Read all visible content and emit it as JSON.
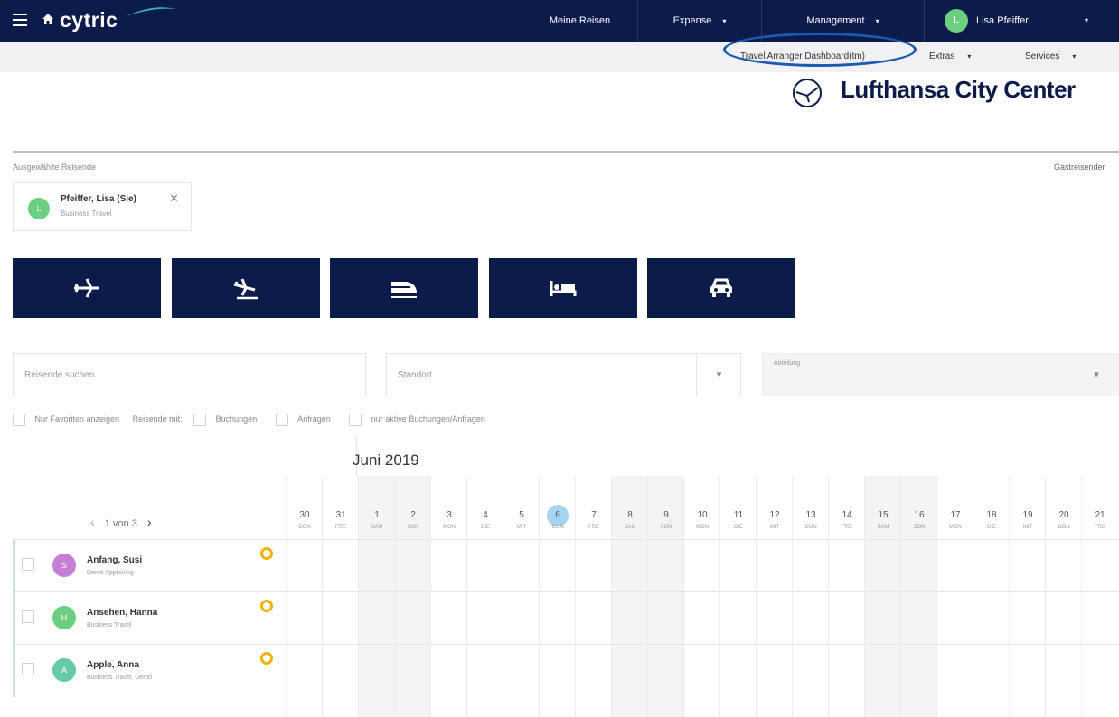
{
  "app": {
    "logo": "cytric"
  },
  "nav": {
    "items": [
      {
        "label": "Meine Reisen"
      },
      {
        "label": "Expense",
        "caret": "▾"
      },
      {
        "label": "Management",
        "caret": "▾"
      }
    ],
    "user": {
      "initial": "L",
      "name": "Lisa Pfeiffer",
      "caret": "▾",
      "avatar_color": "#6ccf7f"
    }
  },
  "subnav": {
    "dashboard": "Travel Arranger Dashboard(tm)",
    "extras": "Extras",
    "services": "Services",
    "caret": "▾"
  },
  "brand": {
    "name": "Lufthansa City Center"
  },
  "selected": {
    "label": "Ausgewählte Reisende",
    "guest_link": "Gastreisender",
    "traveler": {
      "initial": "L",
      "name": "Pfeiffer, Lisa (Sie)",
      "subtitle": "Business Travel",
      "close": "✕"
    }
  },
  "services": [
    {
      "icon": "airplane-icon"
    },
    {
      "icon": "airplane-arrival-icon"
    },
    {
      "icon": "train-icon"
    },
    {
      "icon": "hotel-bed-icon"
    },
    {
      "icon": "car-icon"
    }
  ],
  "search": {
    "traveler_placeholder": "Reisende suchen",
    "location_placeholder": "Standort",
    "department_placeholder": "Abteilung",
    "caret": "▾"
  },
  "filters": {
    "favorites": "Nur Favoriten anzeigen",
    "travelers_with": "Reisende mit:",
    "bookings": "Buchungen",
    "requests": "Anfragen",
    "active_only": "nur aktive Buchungen/Anfragen"
  },
  "calendar": {
    "month": "Juni 2019",
    "pager": {
      "prev": "‹",
      "text": "1 von 3",
      "next": "›"
    },
    "today_index": 7,
    "days": [
      {
        "num": "30",
        "dow": "DON",
        "weekend": false
      },
      {
        "num": "31",
        "dow": "FRE",
        "weekend": false
      },
      {
        "num": "1",
        "dow": "SAM",
        "weekend": true
      },
      {
        "num": "2",
        "dow": "SON",
        "weekend": true
      },
      {
        "num": "3",
        "dow": "MON",
        "weekend": false
      },
      {
        "num": "4",
        "dow": "DIE",
        "weekend": false
      },
      {
        "num": "5",
        "dow": "MIT",
        "weekend": false
      },
      {
        "num": "6",
        "dow": "DON",
        "weekend": false
      },
      {
        "num": "7",
        "dow": "FRE",
        "weekend": false
      },
      {
        "num": "8",
        "dow": "SAM",
        "weekend": true
      },
      {
        "num": "9",
        "dow": "SON",
        "weekend": true
      },
      {
        "num": "10",
        "dow": "MON",
        "weekend": false
      },
      {
        "num": "11",
        "dow": "DIE",
        "weekend": false
      },
      {
        "num": "12",
        "dow": "MIT",
        "weekend": false
      },
      {
        "num": "13",
        "dow": "DON",
        "weekend": false
      },
      {
        "num": "14",
        "dow": "FRE",
        "weekend": false
      },
      {
        "num": "15",
        "dow": "SAM",
        "weekend": true
      },
      {
        "num": "16",
        "dow": "SON",
        "weekend": true
      },
      {
        "num": "17",
        "dow": "MON",
        "weekend": false
      },
      {
        "num": "18",
        "dow": "DIE",
        "weekend": false
      },
      {
        "num": "19",
        "dow": "MIT",
        "weekend": false
      },
      {
        "num": "20",
        "dow": "DON",
        "weekend": false
      },
      {
        "num": "21",
        "dow": "FRE",
        "weekend": false
      }
    ],
    "travelers": [
      {
        "initial": "S",
        "name": "Anfang, Susi",
        "subtitle": "Demo Approving",
        "color": "#c77fd6"
      },
      {
        "initial": "H",
        "name": "Ansehen, Hanna",
        "subtitle": "Business Travel",
        "color": "#6ccf7f"
      },
      {
        "initial": "A",
        "name": "Apple, Anna",
        "subtitle": "Business Travel, Demo",
        "color": "#66c9a8"
      }
    ]
  },
  "colors": {
    "navy": "#0d1b4a",
    "highlight": "#1a5ab0",
    "favorite": "#f1b100",
    "today": "#a6d4f0"
  }
}
